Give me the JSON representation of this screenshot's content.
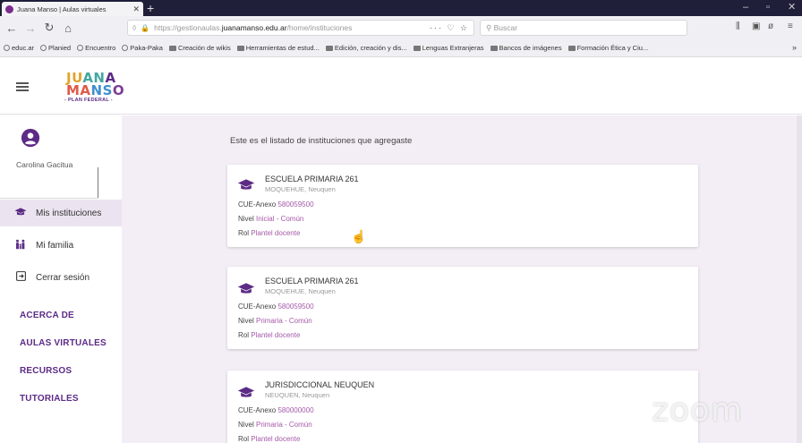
{
  "browser": {
    "tab_title": "Juana Manso | Aulas virtuales",
    "tab_close": "✕",
    "new_tab": "+",
    "url_prefix": "https://gestionaulas.",
    "url_domain": "juanamanso.edu.ar",
    "url_path": "/home/instituciones",
    "url_actions": "··· ♡ ☆",
    "search_placeholder": "Buscar",
    "bookmarks": [
      {
        "label": "educ.ar",
        "type": "globe"
      },
      {
        "label": "Planied",
        "type": "globe"
      },
      {
        "label": "Encuentro",
        "type": "globe"
      },
      {
        "label": "Paka-Paka",
        "type": "globe"
      },
      {
        "label": "Creación de wikis",
        "type": "folder"
      },
      {
        "label": "Herramientas de estud...",
        "type": "folder"
      },
      {
        "label": "Edición, creación y dis...",
        "type": "folder"
      },
      {
        "label": "Lenguas Extranjeras",
        "type": "folder"
      },
      {
        "label": "Bancos de imágenes",
        "type": "folder"
      },
      {
        "label": "Formación Ética y Ciu...",
        "type": "folder"
      }
    ],
    "bookmarks_more": "»"
  },
  "header": {
    "logo_line1": [
      "JU",
      "AN",
      "A"
    ],
    "logo_line2": [
      "MA",
      "NS",
      "O"
    ],
    "logo_subtitle": "- PLAN FEDERAL -"
  },
  "sidebar": {
    "user_name": "Carolina Gacitua",
    "nav": [
      {
        "label": "Mis instituciones",
        "icon": "graduation-cap-icon"
      },
      {
        "label": "Mi familia",
        "icon": "family-icon"
      },
      {
        "label": "Cerrar sesión",
        "icon": "logout-icon"
      }
    ],
    "links": [
      "ACERCA DE",
      "AULAS VIRTUALES",
      "RECURSOS",
      "TUTORIALES"
    ]
  },
  "main": {
    "intro": "Este es el listado de instituciones que agregaste",
    "cards": [
      {
        "name": "ESCUELA PRIMARIA 261",
        "location": "MOQUEHUE, Neuquen",
        "cue_label": "CUE-Anexo",
        "cue": "580059500",
        "nivel_label": "Nivel",
        "nivel": "Inicial - Común",
        "rol_label": "Rol",
        "rol": "Plantel docente"
      },
      {
        "name": "ESCUELA PRIMARIA 261",
        "location": "MOQUEHUE, Neuquen",
        "cue_label": "CUE-Anexo",
        "cue": "580059500",
        "nivel_label": "Nivel",
        "nivel": "Primaria - Común",
        "rol_label": "Rol",
        "rol": "Plantel docente"
      },
      {
        "name": "JURISDICCIONAL NEUQUEN",
        "location": "NEUQUEN, Neuquen",
        "cue_label": "CUE-Anexo",
        "cue": "580000000",
        "nivel_label": "Nivel",
        "nivel": "Primaria - Común",
        "rol_label": "Rol",
        "rol": "Plantel docente"
      }
    ]
  },
  "watermark": "zoom"
}
